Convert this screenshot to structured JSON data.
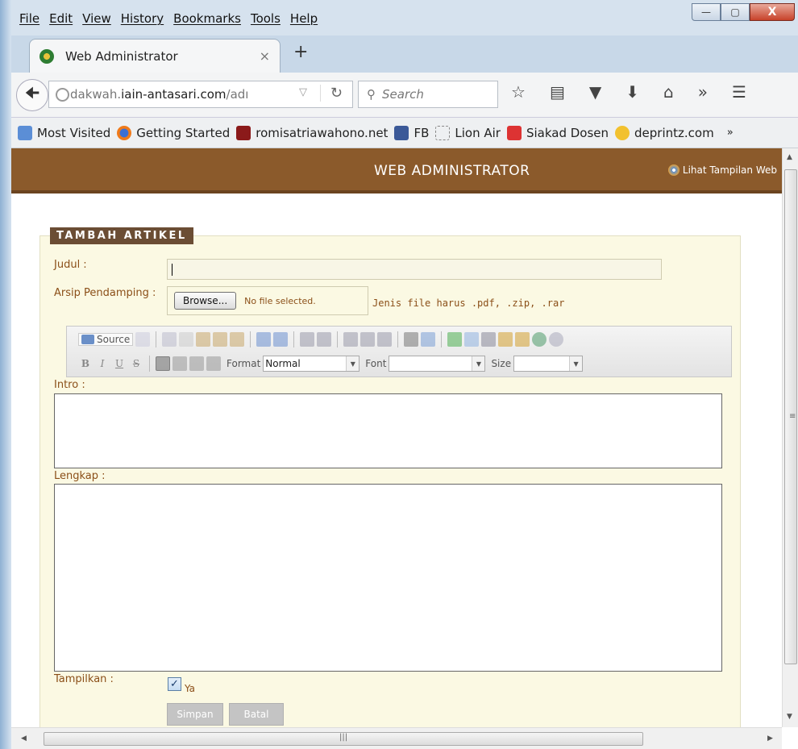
{
  "browser": {
    "menu": [
      "File",
      "Edit",
      "View",
      "History",
      "Bookmarks",
      "Tools",
      "Help"
    ],
    "window_buttons": {
      "minimize": "—",
      "maximize": "▢",
      "close": "X"
    },
    "tab": {
      "title": "Web Administrator",
      "close": "×",
      "new_tab": "+"
    },
    "url": {
      "prefix": "dakwah.",
      "host": "iain-antasari.com",
      "suffix": "/adı"
    },
    "search_placeholder": "Search",
    "bookmarks": [
      "Most Visited",
      "Getting Started",
      "romisatriawahono.net",
      "FB",
      "Lion Air",
      "Siakad Dosen",
      "deprintz.com"
    ],
    "overflow": "»"
  },
  "header": {
    "title": "WEB ADMINISTRATOR",
    "view_link": "Lihat Tampilan Web"
  },
  "form": {
    "legend": "TAMBAH ARTIKEL",
    "judul_label": "Judul :",
    "arsip_label": "Arsip Pendamping :",
    "browse": "Browse...",
    "no_file": "No file selected.",
    "file_note": "Jenis file harus .pdf, .zip, .rar",
    "intro_label": "Intro :",
    "lengkap_label": "Lengkap :",
    "tampilkan_label": "Tampilkan :",
    "ya": "Ya",
    "save": "Simpan",
    "cancel": "Batal"
  },
  "editor": {
    "source": "Source",
    "format_label": "Format",
    "format_value": "Normal",
    "font_label": "Font",
    "size_label": "Size",
    "bold": "B",
    "italic": "I",
    "underline": "U",
    "strike": "S"
  },
  "colors": {
    "header": "#8b5a2b",
    "panel": "#fbf9e3",
    "label": "#8b4f18",
    "legend": "#6b4d34"
  }
}
